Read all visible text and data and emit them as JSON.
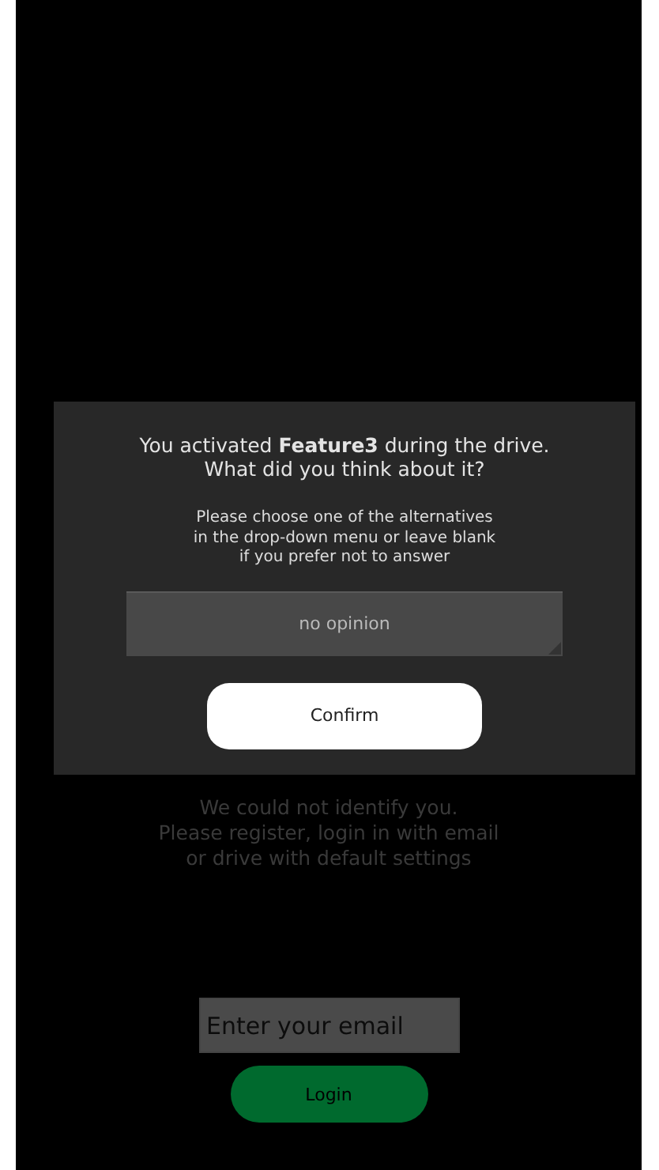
{
  "background": {
    "message": "We could not identify you.\nPlease register, login in with email\nor drive with default settings",
    "email_field": {
      "placeholder": "Enter your email"
    },
    "login_button": "Login"
  },
  "dialog": {
    "question": "You activated **Feature3** during the drive.\nWhat did you think about it?",
    "instructions": "Please choose one of the alternatives\nin the drop-down menu or leave blank\nif you prefer not to answer",
    "dropdown": {
      "value": "no opinion"
    },
    "confirm_button": "Confirm"
  }
}
